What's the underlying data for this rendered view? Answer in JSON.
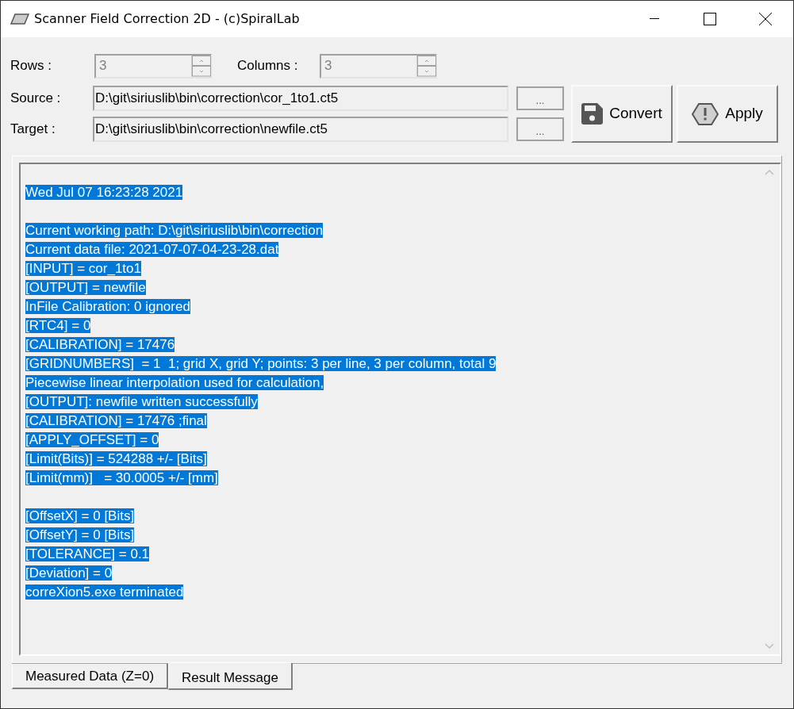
{
  "window": {
    "title": "Scanner Field Correction 2D - (c)SpiralLab"
  },
  "rows": {
    "label": "Rows :",
    "value": "3",
    "disabled": true
  },
  "columns": {
    "label": "Columns :",
    "value": "3",
    "disabled": true
  },
  "source": {
    "label": "Source :",
    "value": "D:\\git\\siriuslib\\bin\\correction\\cor_1to1.ct5",
    "browse": "..."
  },
  "target": {
    "label": "Target :",
    "value": "D:\\git\\siriuslib\\bin\\correction\\newfile.ct5",
    "browse": "..."
  },
  "buttons": [
    {
      "kind": "convert",
      "label": "Convert"
    },
    {
      "kind": "apply",
      "label": "Apply"
    }
  ],
  "log": {
    "selected": true,
    "paragraphs": [
      [
        "Wed Jul 07 16:23:28 2021"
      ],
      [
        "Current working path: D:\\git\\siriuslib\\bin\\correction",
        "Current data file: 2021-07-07-04-23-28.dat",
        "[INPUT] = cor_1to1",
        "[OUTPUT] = newfile",
        "InFile Calibration: 0 ignored",
        "[RTC4] = 0",
        "[CALIBRATION] = 17476",
        "[GRIDNUMBERS]  = 1  1; grid X, grid Y; points: 3 per line, 3 per column, total 9",
        "Piecewise linear interpolation used for calculation,",
        "[OUTPUT]: newfile written successfully",
        "[CALIBRATION] = 17476 ;final",
        "[APPLY_OFFSET] = 0",
        "[Limit(Bits)] = 524288 +/- [Bits]",
        "[Limit(mm)]   = 30.0005 +/- [mm]"
      ],
      [
        "[OffsetX] = 0 [Bits]",
        "[OffsetY] = 0 [Bits]",
        "[TOLERANCE] = 0.1",
        "[Deviation] = 0",
        "correXion5.exe terminated"
      ]
    ]
  },
  "tabs": [
    {
      "label": "Measured Data (Z=0)",
      "selected": false
    },
    {
      "label": "Result Message",
      "selected": true
    }
  ]
}
